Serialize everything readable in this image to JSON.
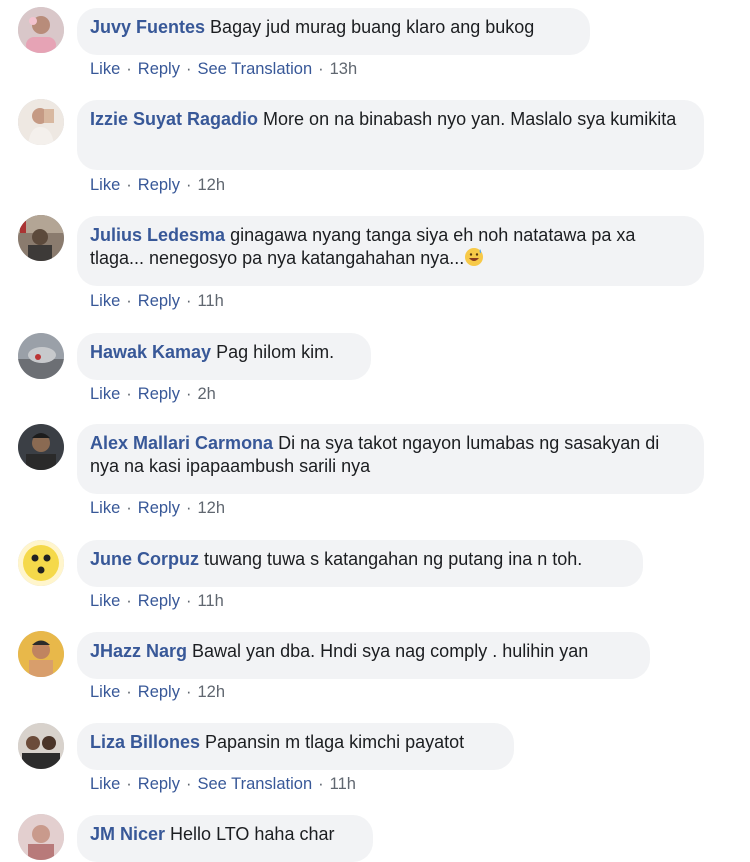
{
  "actions": {
    "like": "Like",
    "reply": "Reply",
    "see_translation": "See Translation",
    "separator": "·"
  },
  "comments": [
    {
      "author": "Juvy Fuentes",
      "text": "Bagay jud murag buang klaro ang bukog",
      "time": "13h",
      "translation": true
    },
    {
      "author": "Izzie Suyat Ragadio",
      "text": "More on na binabash nyo yan. Maslalo sya kumikita",
      "time": "12h",
      "translation": false
    },
    {
      "author": "Julius Ledesma",
      "text": "ginagawa nyang tanga siya eh noh natatawa pa xa tlaga... nenegosyo pa nya katangahahan nya...",
      "time": "11h",
      "translation": false,
      "emoji": "grinning-sweat-emoji"
    },
    {
      "author": "Hawak Kamay",
      "text": "Pag hilom kim.",
      "time": "2h",
      "translation": false
    },
    {
      "author": "Alex Mallari Carmona",
      "text": "Di na sya takot ngayon lumabas ng sasakyan di nya na kasi ipapaambush sarili nya",
      "time": "12h",
      "translation": false
    },
    {
      "author": "June Corpuz",
      "text": "tuwang tuwa s katangahan ng putang ina n toh.",
      "time": "11h",
      "translation": false
    },
    {
      "author": "JHazz Narg",
      "text": "Bawal yan dba. Hndi sya nag comply . hulihin yan",
      "time": "12h",
      "translation": false
    },
    {
      "author": "Liza Billones",
      "text": "Papansin m tlaga kimchi payatot",
      "time": "11h",
      "translation": true
    },
    {
      "author": "JM Nicer",
      "text": "Hello LTO haha char",
      "time": "",
      "translation": false
    }
  ],
  "colors": {
    "author": "#385898",
    "bubble": "#f2f3f5",
    "meta": "#606770"
  }
}
